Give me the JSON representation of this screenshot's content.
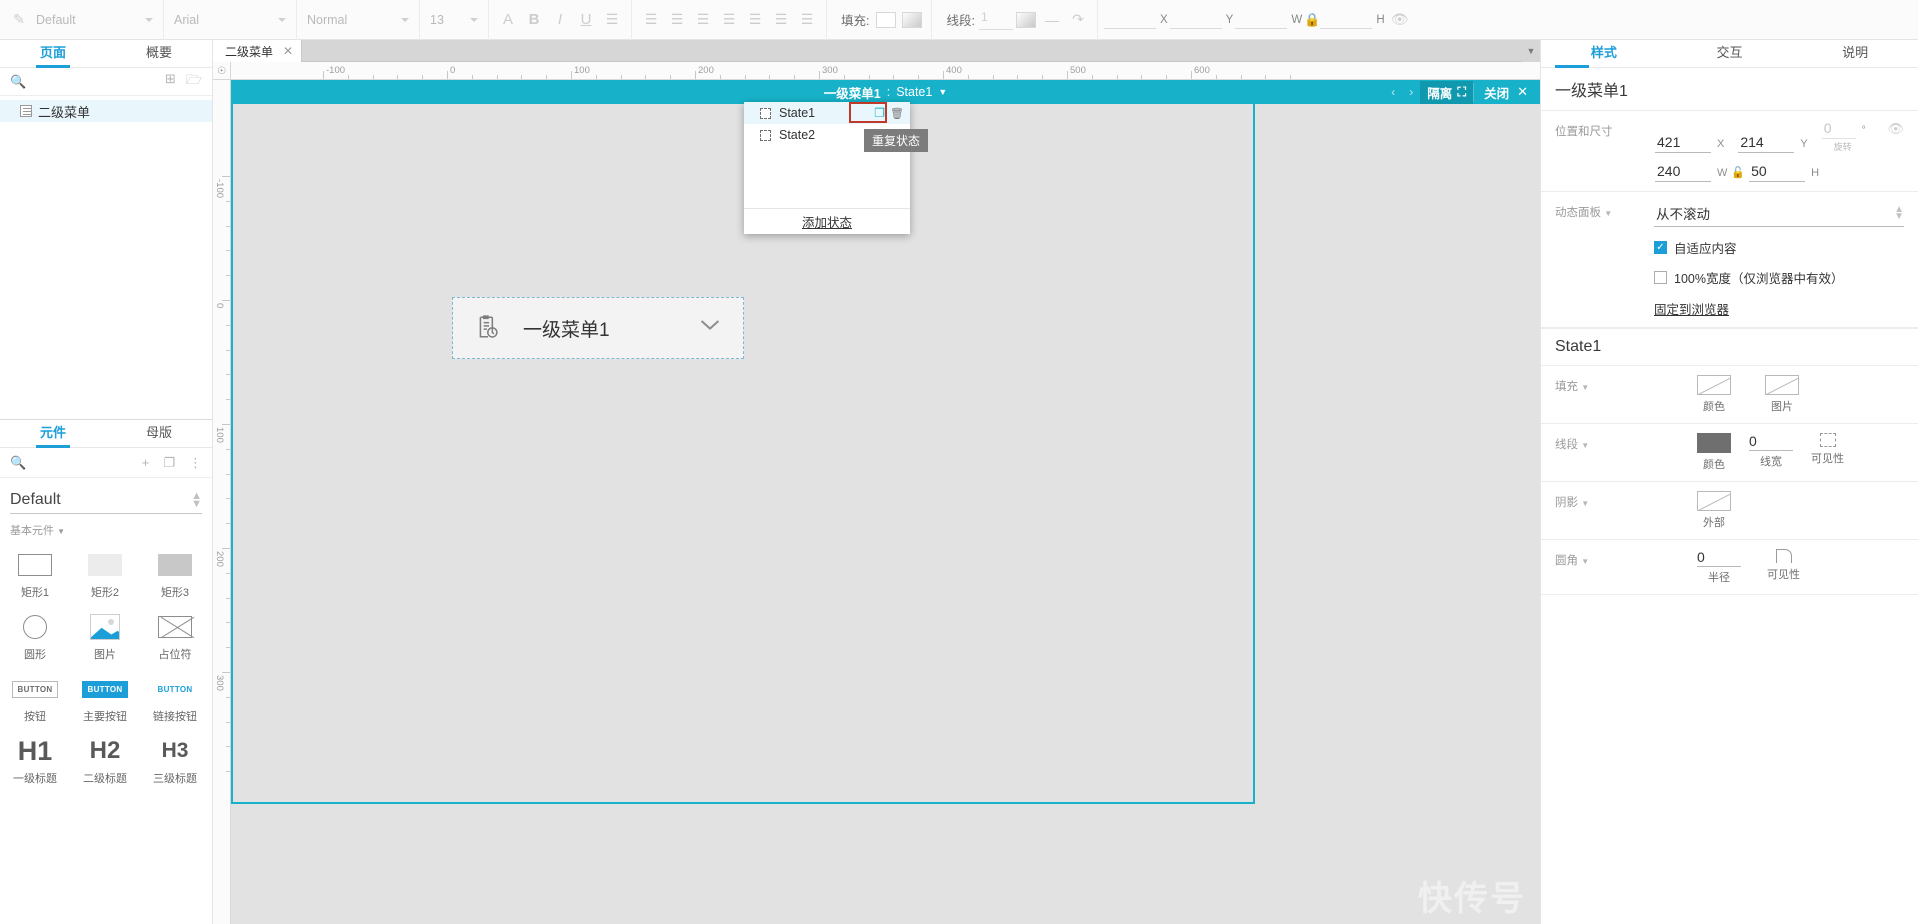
{
  "toolbar": {
    "style_select": "Default",
    "font_select": "Arial",
    "weight_select": "Normal",
    "size_select": "13",
    "fill_label": "填充:",
    "line_label": "线段:",
    "line_width_value": "1",
    "coord_x_label": "X",
    "coord_y_label": "Y",
    "coord_w_label": "W",
    "coord_h_label": "H"
  },
  "left_panel": {
    "tabs": [
      {
        "label": "页面",
        "active": true
      },
      {
        "label": "概要",
        "active": false
      }
    ],
    "pages": [
      {
        "label": "二级菜单",
        "selected": true
      }
    ],
    "widgets": {
      "tabs": [
        {
          "label": "元件",
          "active": true
        },
        {
          "label": "母版",
          "active": false
        }
      ],
      "library": "Default",
      "group_title": "基本元件",
      "items": [
        {
          "caption": "矩形1",
          "icon": "rectangle-outline-icon"
        },
        {
          "caption": "矩形2",
          "icon": "rectangle-light-icon"
        },
        {
          "caption": "矩形3",
          "icon": "rectangle-grey-icon"
        },
        {
          "caption": "圆形",
          "icon": "circle-icon"
        },
        {
          "caption": "图片",
          "icon": "image-icon"
        },
        {
          "caption": "占位符",
          "icon": "placeholder-icon"
        },
        {
          "caption": "按钮",
          "icon": "button-outline-icon",
          "glyph": "BUTTON"
        },
        {
          "caption": "主要按钮",
          "icon": "button-primary-icon",
          "glyph": "BUTTON"
        },
        {
          "caption": "链接按钮",
          "icon": "button-link-icon",
          "glyph": "BUTTON"
        },
        {
          "caption": "一级标题",
          "icon": "heading1-icon",
          "glyph": "H1"
        },
        {
          "caption": "二级标题",
          "icon": "heading2-icon",
          "glyph": "H2"
        },
        {
          "caption": "三级标题",
          "icon": "heading3-icon",
          "glyph": "H3"
        }
      ]
    }
  },
  "canvas": {
    "doc_tab": "二级菜单",
    "isolation_bar": {
      "widget_name": "一级菜单1",
      "separator": ":",
      "state_name": "State1",
      "isolate_label": "隔离",
      "close_label": "关闭"
    },
    "widget": {
      "label": "一级菜单1",
      "icon": "clipboard-clock-icon",
      "chevron": "chevron-down-icon"
    },
    "state_popup": {
      "states": [
        {
          "name": "State1",
          "selected": true
        },
        {
          "name": "State2",
          "selected": false
        }
      ],
      "duplicate_icon": "duplicate-icon",
      "delete_icon": "trash-icon",
      "add_label": "添加状态",
      "tooltip": "重复状态"
    },
    "watermark": "快传号",
    "ruler_h_labels": [
      "-100",
      "0",
      "100",
      "200",
      "300",
      "400",
      "500",
      "600"
    ],
    "ruler_v_labels": [
      "-100",
      "0",
      "100",
      "200",
      "300"
    ]
  },
  "right_panel": {
    "tabs": [
      {
        "label": "样式",
        "active": true
      },
      {
        "label": "交互",
        "active": false
      },
      {
        "label": "说明",
        "active": false
      }
    ],
    "widget_title": "一级菜单1",
    "position_size": {
      "label": "位置和尺寸",
      "x": "421",
      "x_unit": "X",
      "y": "214",
      "y_unit": "Y",
      "rotation": "0",
      "rotation_unit": "°",
      "rotation_caption": "旋转",
      "w": "240",
      "w_unit": "W",
      "h": "50",
      "h_unit": "H"
    },
    "dynamic_panel": {
      "label": "动态面板",
      "scroll_value": "从不滚动",
      "fit_content_label": "自适应内容",
      "fit_content_checked": true,
      "full_width_label": "100%宽度（仅浏览器中有效）",
      "full_width_checked": false,
      "pin_browser_label": "固定到浏览器"
    },
    "state_section_title": "State1",
    "fill": {
      "label": "填充",
      "options": [
        {
          "caption": "颜色",
          "icon": "fill-color-icon"
        },
        {
          "caption": "图片",
          "icon": "fill-image-icon"
        }
      ]
    },
    "line": {
      "label": "线段",
      "color_caption": "颜色",
      "width_value": "0",
      "width_caption": "线宽",
      "visibility_caption": "可见性"
    },
    "shadow": {
      "label": "阴影",
      "outer_caption": "外部"
    },
    "corner": {
      "label": "圆角",
      "radius_value": "0",
      "radius_caption": "半径",
      "visibility_caption": "可见性"
    }
  }
}
